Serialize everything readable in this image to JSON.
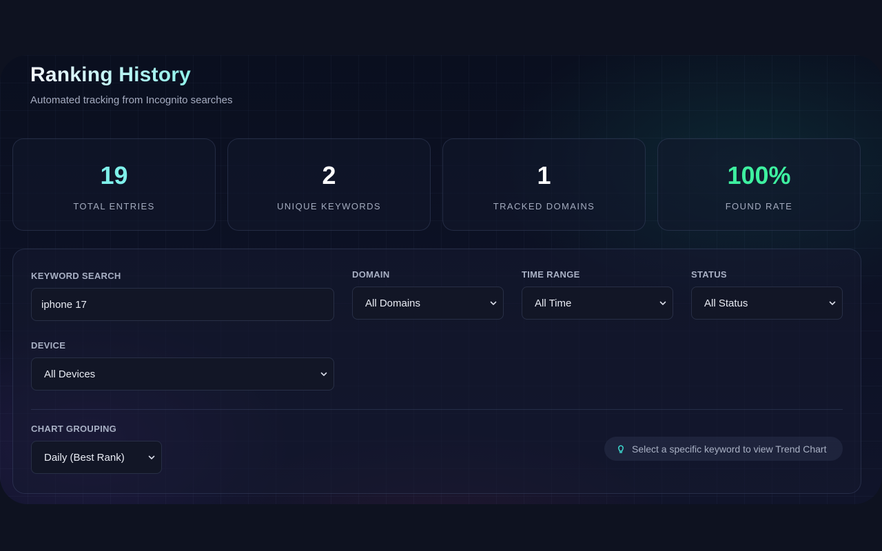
{
  "header": {
    "title": "Ranking History",
    "subtitle": "Automated tracking from Incognito searches"
  },
  "stats": [
    {
      "value": "19",
      "label": "TOTAL ENTRIES",
      "color": "#7ff0ea"
    },
    {
      "value": "2",
      "label": "UNIQUE KEYWORDS",
      "color": "#ffffff"
    },
    {
      "value": "1",
      "label": "TRACKED DOMAINS",
      "color": "#ffffff"
    },
    {
      "value": "100%",
      "label": "FOUND RATE",
      "color": "#3ef0a0"
    }
  ],
  "filters": {
    "keyword": {
      "label": "KEYWORD SEARCH",
      "value": "iphone 17"
    },
    "domain": {
      "label": "DOMAIN",
      "selected": "All Domains"
    },
    "time_range": {
      "label": "TIME RANGE",
      "selected": "All Time"
    },
    "status": {
      "label": "STATUS",
      "selected": "All Status"
    },
    "device": {
      "label": "DEVICE",
      "selected": "All Devices"
    },
    "chart_grouping": {
      "label": "CHART GROUPING",
      "selected": "Daily (Best Rank)"
    }
  },
  "hint": {
    "icon": "lightbulb-icon",
    "text": "Select a specific keyword to view Trend Chart"
  },
  "colors": {
    "accent_teal": "#7ff0ea",
    "accent_green": "#3ef0a0",
    "background": "#0e1220"
  }
}
